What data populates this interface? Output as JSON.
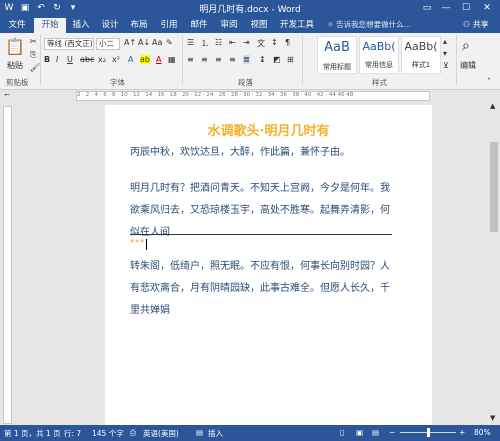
{
  "titlebar": {
    "title": "明月几时有.docx - Word",
    "save_icon": "▣",
    "undo_icon": "↶",
    "redo_icon": "↻",
    "customize_icon": "▾",
    "ribbon_display_icon": "▭",
    "minimize_icon": "—",
    "maximize_icon": "☐",
    "close_icon": "✕"
  },
  "tabs": {
    "file": "文件",
    "home": "开始",
    "insert": "插入",
    "design": "设计",
    "layout": "布局",
    "references": "引用",
    "mailings": "邮件",
    "review": "审阅",
    "view": "视图",
    "developer": "开发工具",
    "tell_me": "告诉我您想要做什么...",
    "share": "共享"
  },
  "ribbon": {
    "paste": "粘贴",
    "clipboard_label": "剪贴板",
    "font_name": "等线 (西文正)",
    "font_size": "小二",
    "font_label": "字体",
    "paragraph_label": "段落",
    "styles_label": "样式",
    "editing": "编辑",
    "style_sample": "AaB",
    "style_heading_sample": "AaBb(",
    "style_title_sample": "AaBb(",
    "style_normal": "常用标题",
    "style_heading": "常用信息",
    "style_title": "样式1",
    "bold": "B",
    "italic": "I",
    "underline": "U",
    "strike": "abc",
    "subscript": "x₂",
    "superscript": "x²",
    "font_color": "A",
    "highlight": "ab"
  },
  "ruler": {
    "ticks": "2 · 2 · 4 · 6 · 8 · 10 · 12 · 14 · 16 · 18 · 20 · 22 · 24 · 26 · 28 · 30 · 32 · 34 · 36 · 38 · 40 · 42 · 44 46 48"
  },
  "document": {
    "heading": "水调歌头·明月几时有",
    "line1": "丙辰中秋，欢饮达旦，大醉，作此篇，兼怀子由。",
    "para2": "明月几时有？把酒问青天。不知天上宫阙，今夕是何年。我欲乘风归去，又恐琼楼玉宇，高处不胜寒。起舞弄清影，何似在人间",
    "marker": "***",
    "para3": "转朱阁，低绮户，照无眠。不应有恨，何事长向别时园？人有悲欢离合，月有阴晴园缺，此事古难全。但愿人长久，千里共婵娟"
  },
  "status": {
    "page": "第 1 页，共 1 页",
    "line": "行: 7",
    "words": "145 个字",
    "language": "英语(美国)",
    "mode": "插入",
    "zoom": "80%",
    "zoom_minus": "−",
    "zoom_plus": "+"
  },
  "colors": {
    "accent": "#2b579a",
    "heading": "#f4b12a",
    "body_text": "#2b4b7a"
  }
}
